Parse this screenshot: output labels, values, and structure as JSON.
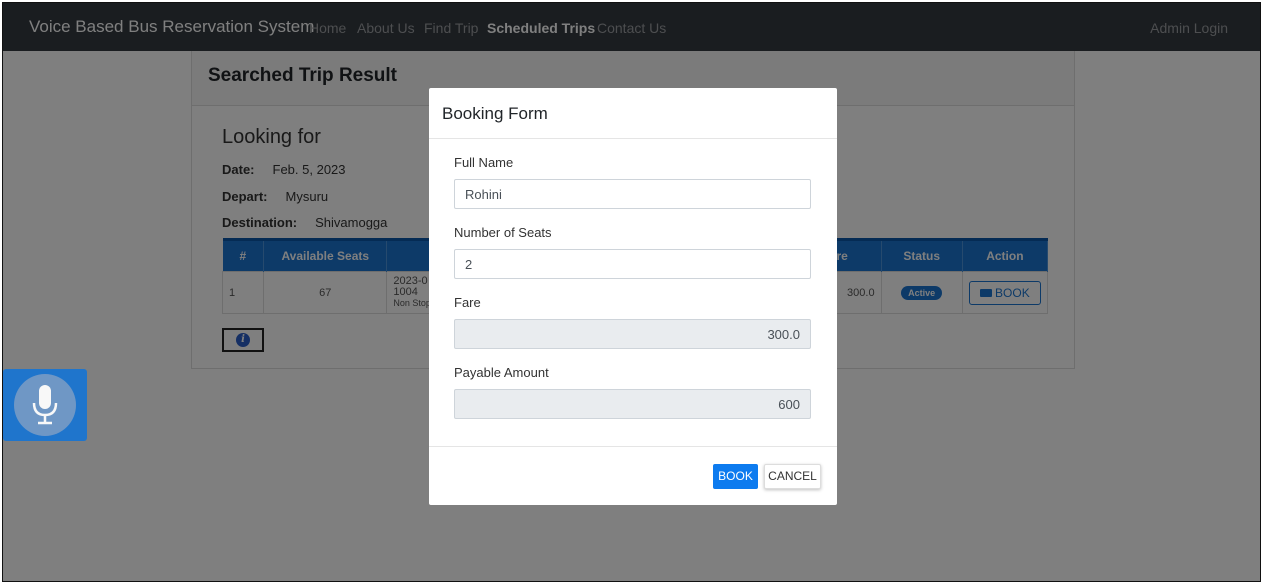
{
  "navbar": {
    "brand": "Voice Based Bus Reservation System",
    "links": [
      {
        "label": "Home",
        "active": false
      },
      {
        "label": "About Us",
        "active": false
      },
      {
        "label": "Find Trip",
        "active": false
      },
      {
        "label": "Scheduled Trips",
        "active": true
      },
      {
        "label": "Contact Us",
        "active": false
      }
    ],
    "admin_login": "Admin Login"
  },
  "result": {
    "title": "Searched Trip Result",
    "looking_for": "Looking for",
    "date_label": "Date:",
    "date_value": "Feb. 5, 2023",
    "depart_label": "Depart:",
    "depart_value": "Mysuru",
    "destination_label": "Destination:",
    "destination_value": "Shivamogga",
    "table": {
      "headers": [
        "#",
        "Available Seats",
        "",
        "re",
        "Status",
        "Action"
      ],
      "row": {
        "num": "1",
        "seats": "67",
        "schedule_line1": "2023-0",
        "schedule_line2": "1004",
        "schedule_line3": "Non Stop",
        "fare": "300.0",
        "status": "Active",
        "action": "BOOK"
      }
    }
  },
  "modal": {
    "title": "Booking Form",
    "full_name_label": "Full Name",
    "full_name_value": "Rohini",
    "seats_label": "Number of Seats",
    "seats_value": "2",
    "fare_label": "Fare",
    "fare_value": "300.0",
    "payable_label": "Payable Amount",
    "payable_value": "600",
    "book_button": "BOOK",
    "cancel_button": "CANCEL"
  },
  "colors": {
    "navbar": "#343a40",
    "primary": "#0d7bef",
    "table_header": "#1a75d1"
  },
  "icons": {
    "mic": "microphone-icon",
    "info": "info-icon",
    "ticket": "ticket-icon"
  }
}
